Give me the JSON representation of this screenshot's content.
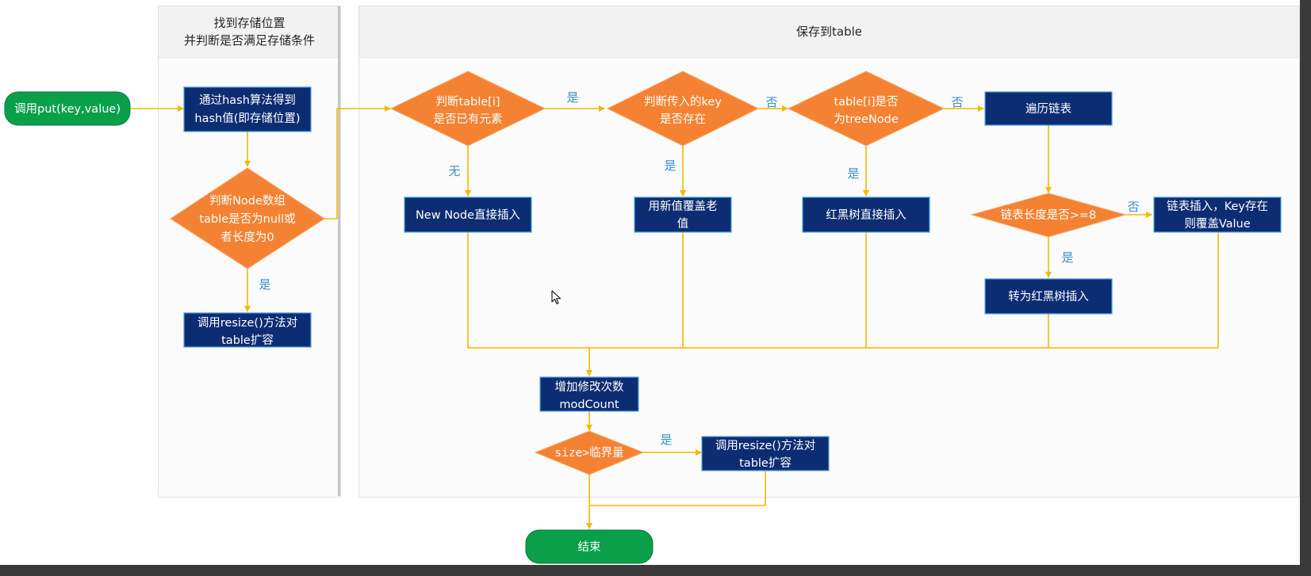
{
  "lanes": {
    "left_header_line1": "找到存储位置",
    "left_header_line2": "并判断是否满足存储条件",
    "right_header": "保存到table"
  },
  "nodes": {
    "start": "调用put(key,value)",
    "hash_line1": "通过hash算法得到",
    "hash_line2": "hash值(即存储位置)",
    "check_table_line1": "判断Node数组",
    "check_table_line2": "table是否为null或",
    "check_table_line3": "者长度为0",
    "resize1_line1": "调用resize()方法对",
    "resize1_line2": "table扩容",
    "has_elem_line1": "判断table[i]",
    "has_elem_line2": "是否已有元素",
    "new_node": "New Node直接插入",
    "key_exists_line1": "判断传入的key",
    "key_exists_line2": "是否存在",
    "overwrite_line1": "用新值覆盖老",
    "overwrite_line2": "值",
    "is_tree_line1": "table[i]是否",
    "is_tree_line2": "为treeNode",
    "rb_insert": "红黑树直接插入",
    "traverse": "遍历链表",
    "len_check": "链表长度是否>=8",
    "list_insert_line1": "链表插入，Key存在",
    "list_insert_line2": "则覆盖Value",
    "to_rb": "转为红黑树插入",
    "modcount_line1": "增加修改次数",
    "modcount_line2": "modCount",
    "size_check": "size>临界量",
    "resize2_line1": "调用resize()方法对",
    "resize2_line2": "table扩容",
    "end": "结束"
  },
  "edge_labels": {
    "yes_resize1": "是",
    "none_new_node": "无",
    "yes_key_check": "是",
    "yes_overwrite": "是",
    "no_is_tree": "否",
    "yes_rb": "是",
    "no_traverse": "否",
    "no_list_insert": "否",
    "yes_to_rb": "是",
    "yes_resize2": "是"
  },
  "colors": {
    "process_fill": "#0d2d73",
    "decision_fill": "#f58232",
    "terminal_fill": "#0aa04a",
    "edge": "#f5b800",
    "edge_label": "#3a8fd0"
  },
  "icons": {
    "cursor": "mouse-pointer-icon"
  }
}
